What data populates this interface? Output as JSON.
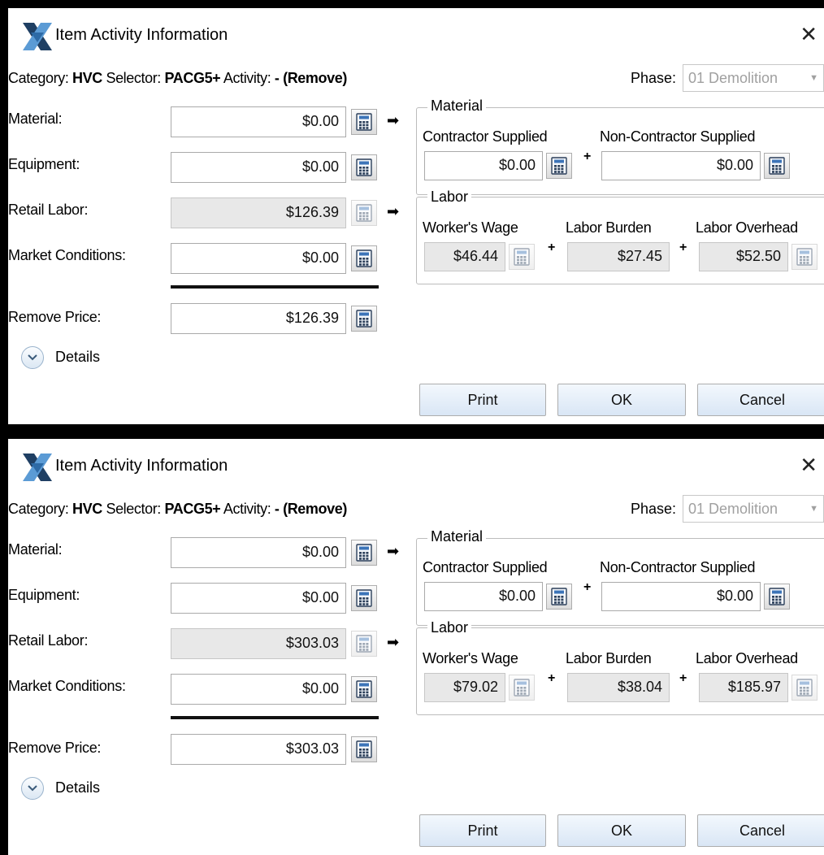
{
  "dialogs": [
    {
      "title": "Item Activity Information",
      "close": "✕",
      "info": {
        "category_label": "Category: ",
        "category_value": "HVC",
        "selector_label": " Selector: ",
        "selector_value": "PACG5+",
        "activity_label": " Activity: ",
        "activity_value": "- (Remove)"
      },
      "phase": {
        "label": "Phase:",
        "value": "01 Demolition"
      },
      "rows": {
        "material": {
          "label": "Material:",
          "value": "$0.00"
        },
        "equipment": {
          "label": "Equipment:",
          "value": "$0.00"
        },
        "retail_labor": {
          "label": "Retail Labor:",
          "value": "$126.39"
        },
        "market_conditions": {
          "label": "Market Conditions:",
          "value": "$0.00"
        },
        "remove_price": {
          "label": "Remove Price:",
          "value": "$126.39"
        }
      },
      "material_group": {
        "legend": "Material",
        "contractor_label": "Contractor Supplied",
        "contractor_value": "$0.00",
        "non_contractor_label": "Non-Contractor Supplied",
        "non_contractor_value": "$0.00"
      },
      "labor_group": {
        "legend": "Labor",
        "wage_label": "Worker's Wage",
        "wage_value": "$46.44",
        "burden_label": "Labor Burden",
        "burden_value": "$27.45",
        "overhead_label": "Labor Overhead",
        "overhead_value": "$52.50"
      },
      "details_label": "Details",
      "buttons": {
        "print": "Print",
        "ok": "OK",
        "cancel": "Cancel"
      }
    },
    {
      "title": "Item Activity Information",
      "close": "✕",
      "info": {
        "category_label": "Category: ",
        "category_value": "HVC",
        "selector_label": " Selector: ",
        "selector_value": "PACG5+",
        "activity_label": " Activity: ",
        "activity_value": "- (Remove)"
      },
      "phase": {
        "label": "Phase:",
        "value": "01 Demolition"
      },
      "rows": {
        "material": {
          "label": "Material:",
          "value": "$0.00"
        },
        "equipment": {
          "label": "Equipment:",
          "value": "$0.00"
        },
        "retail_labor": {
          "label": "Retail Labor:",
          "value": "$303.03"
        },
        "market_conditions": {
          "label": "Market Conditions:",
          "value": "$0.00"
        },
        "remove_price": {
          "label": "Remove Price:",
          "value": "$303.03"
        }
      },
      "material_group": {
        "legend": "Material",
        "contractor_label": "Contractor Supplied",
        "contractor_value": "$0.00",
        "non_contractor_label": "Non-Contractor Supplied",
        "non_contractor_value": "$0.00"
      },
      "labor_group": {
        "legend": "Labor",
        "wage_label": "Worker's Wage",
        "wage_value": "$79.02",
        "burden_label": "Labor Burden",
        "burden_value": "$38.04",
        "overhead_label": "Labor Overhead",
        "overhead_value": "$185.97"
      },
      "details_label": "Details",
      "buttons": {
        "print": "Print",
        "ok": "OK",
        "cancel": "Cancel"
      }
    }
  ],
  "icons": {
    "app": "app-logo-icon",
    "calculator": "calculator-icon",
    "arrow": "arrow-right-icon",
    "expand": "chevron-down-icon",
    "close": "close-icon",
    "dropdown": "dropdown-caret-icon"
  },
  "colors": {
    "outer_background": "#000000",
    "button_top": "#f3f8fd",
    "button_bottom": "#d9e6f5",
    "readonly_field": "#e8e8e8",
    "logo_dark": "#1f3f63",
    "logo_light": "#5b9bd5"
  }
}
